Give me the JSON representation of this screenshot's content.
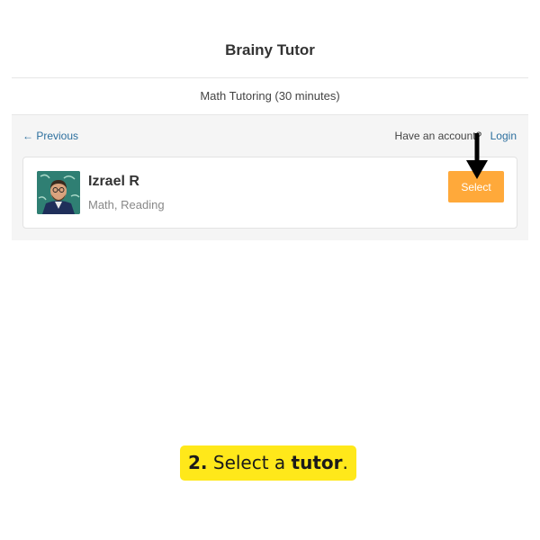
{
  "app": {
    "title": "Brainy Tutor"
  },
  "service": {
    "name": "Math Tutoring (30 minutes)"
  },
  "nav": {
    "previous_label": "Previous",
    "previous_arrow": "←",
    "account_prompt": "Have an account?",
    "login_label": "Login"
  },
  "tutor": {
    "name": "Izrael R",
    "subjects": "Math, Reading",
    "select_label": "Select"
  },
  "instruction": {
    "step": "2.",
    "text_before": "Select a",
    "highlight": "tutor",
    "text_after": "."
  },
  "colors": {
    "accent": "#ffa93a",
    "link": "#2c6f9e",
    "highlight_bg": "#ffe81a"
  },
  "icons": {
    "annotation_arrow": "arrow-down-icon",
    "avatar": "tutor-avatar"
  }
}
